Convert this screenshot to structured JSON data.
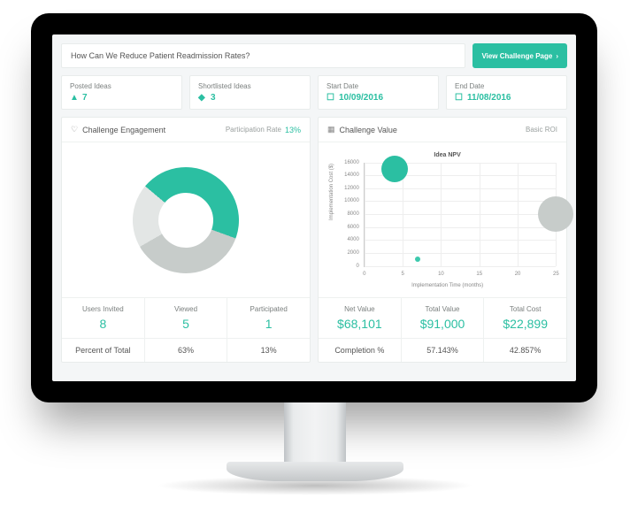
{
  "header": {
    "title": "How Can We Reduce Patient Readmission Rates?",
    "button": "View Challenge Page"
  },
  "stats": {
    "posted": {
      "label": "Posted Ideas",
      "value": "7"
    },
    "shortlisted": {
      "label": "Shortlisted Ideas",
      "value": "3"
    },
    "start": {
      "label": "Start Date",
      "value": "10/09/2016"
    },
    "end": {
      "label": "End Date",
      "value": "11/08/2016"
    }
  },
  "engagement": {
    "title": "Challenge Engagement",
    "sublabel": "Participation Rate",
    "rate": "13%",
    "metrics": {
      "users_invited": {
        "label": "Users Invited",
        "value": "8"
      },
      "viewed": {
        "label": "Viewed",
        "value": "5"
      },
      "participated": {
        "label": "Participated",
        "value": "1"
      }
    },
    "percent_row": {
      "label": "Percent of Total",
      "viewed_pct": "63%",
      "participated_pct": "13%"
    }
  },
  "value": {
    "title": "Challenge Value",
    "sublabel": "Basic ROI",
    "metrics": {
      "net": {
        "label": "Net Value",
        "value": "$68,101"
      },
      "total": {
        "label": "Total Value",
        "value": "$91,000"
      },
      "cost": {
        "label": "Total Cost",
        "value": "$22,899"
      }
    },
    "completion_row": {
      "label": "Completion %",
      "total_pct": "57.143%",
      "cost_pct": "42.857%"
    }
  },
  "chart_data": {
    "type": "scatter",
    "title": "Idea NPV",
    "xlabel": "Implementation Time (months)",
    "ylabel": "Implementation Cost ($)",
    "xlim": [
      0,
      25
    ],
    "ylim": [
      0,
      16000
    ],
    "xticks": [
      0,
      5,
      10,
      15,
      20,
      25
    ],
    "yticks": [
      0,
      2000,
      4000,
      6000,
      8000,
      10000,
      12000,
      14000,
      16000
    ],
    "series": [
      {
        "name": "bubble-large-teal",
        "x": 4,
        "y": 15000,
        "size": 30,
        "color": "#2bbfa2"
      },
      {
        "name": "bubble-small-teal",
        "x": 7,
        "y": 1000,
        "size": 6,
        "color": "#3cc9ad"
      },
      {
        "name": "bubble-large-grey",
        "x": 25,
        "y": 8000,
        "size": 40,
        "color": "#c7ccca"
      }
    ]
  }
}
